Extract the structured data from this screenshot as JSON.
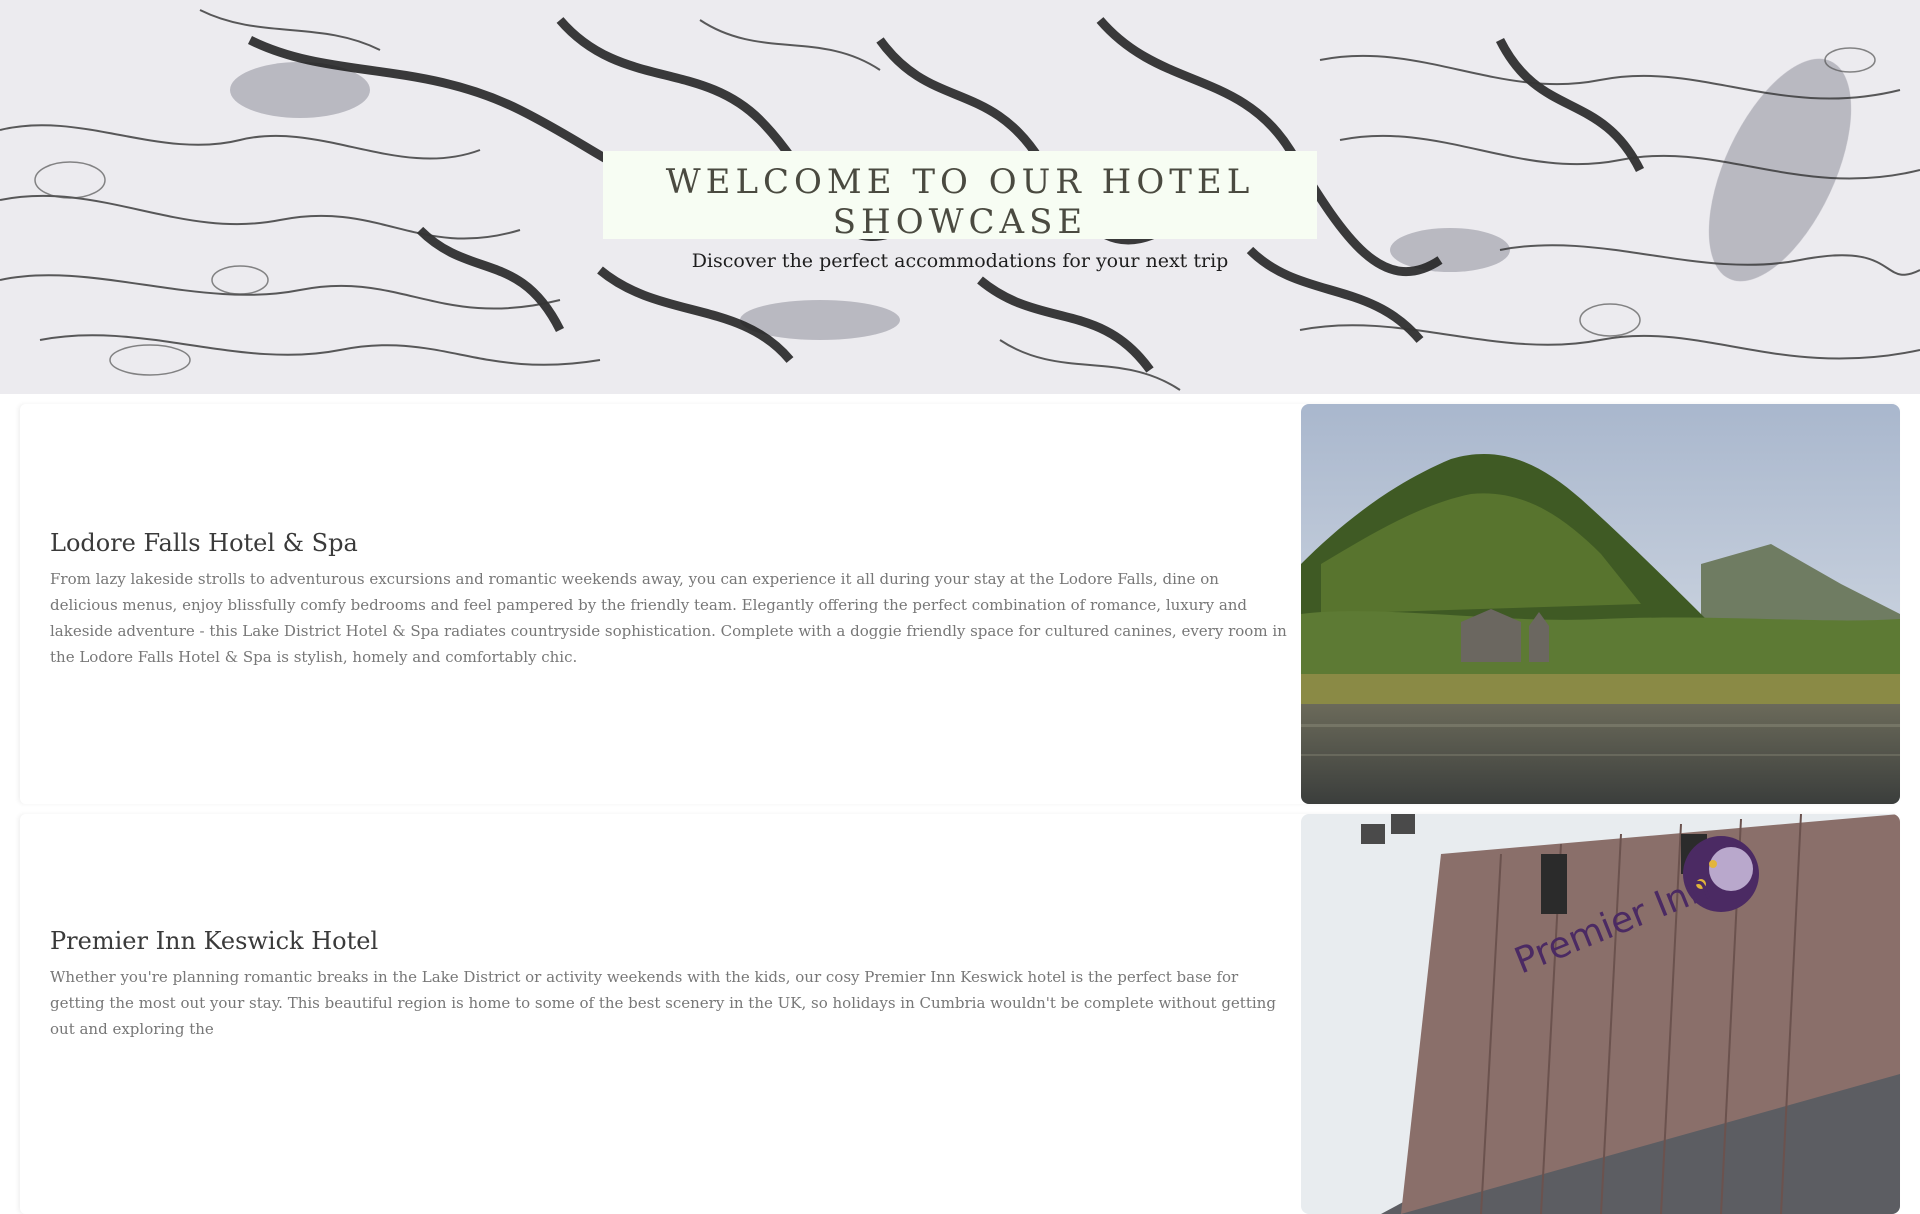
{
  "hero": {
    "title": "WELCOME TO OUR HOTEL SHOWCASE",
    "subtitle": "Discover the perfect accommodations for your next trip",
    "background_image": "topographic-contour-map"
  },
  "hotels": [
    {
      "name": "Lodore Falls Hotel & Spa",
      "description": "From lazy lakeside strolls to adventurous excursions and romantic weekends away, you can experience it all during your stay at the Lodore Falls, dine on delicious menus, enjoy blissfully comfy bedrooms and feel pampered by the friendly team. Elegantly offering the perfect combination of romance, luxury and lakeside adventure - this Lake District Hotel & Spa radiates countryside sophistication. Complete with a doggie friendly space for cultured canines, every room in the Lodore Falls Hotel & Spa is stylish, homely and comfortably chic.",
      "image": "lakeside-hotel-mountain-photo"
    },
    {
      "name": "Premier Inn Keswick Hotel",
      "description": "Whether you're planning romantic breaks in the Lake District or activity weekends with the kids, our cosy Premier Inn Keswick hotel is the perfect base for getting the most out your stay. This beautiful region is home to some of the best scenery in the UK, so holidays in Cumbria wouldn't be complete without getting out and exploring the",
      "image": "premier-inn-building-photo",
      "sign_text": "Premier Inn"
    }
  ],
  "colors": {
    "hero_box_bg": "#f7fdf3",
    "title_color": "#4a4a40",
    "body_text": "#777777",
    "premier_purple": "#4b2a63"
  }
}
